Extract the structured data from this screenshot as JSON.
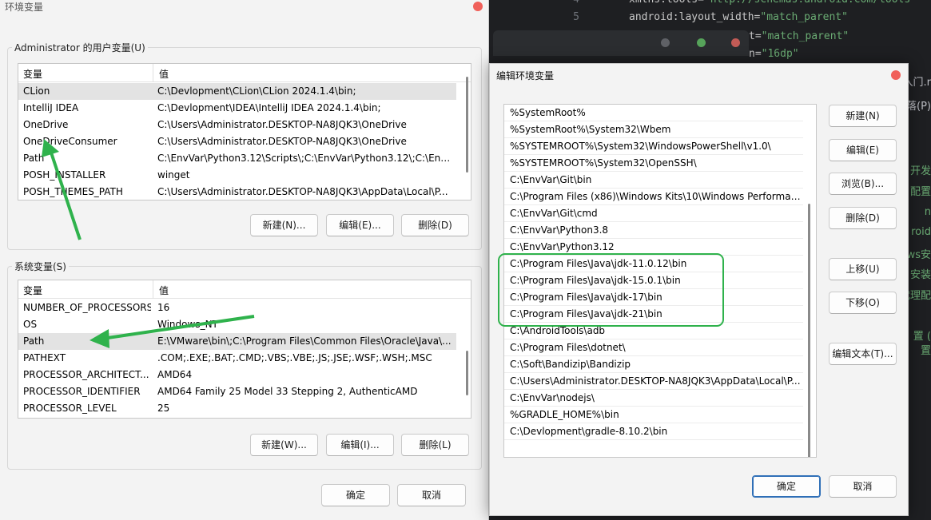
{
  "ide": {
    "lines": [
      {
        "num": "4",
        "attr": "xmlns:tools=",
        "val": "\"http://schemas.android.com/tools\""
      },
      {
        "num": "5",
        "attr": "android:layout_width=",
        "val": "\"match_parent\""
      },
      {
        "num": "",
        "attr": "t=",
        "val": "\"match_parent\""
      },
      {
        "num": "",
        "attr": "n=",
        "val": "\"16dp\""
      }
    ],
    "right_fragments": [
      "入门.r",
      "落(P)",
      "开发",
      "配置",
      "n",
      "roid",
      "ws安",
      "安装",
      "代理配",
      "置 (",
      "置"
    ],
    "right_fragment_colors": [
      "#bcbec4",
      "#bcbec4",
      "#6aab73",
      "#6aab73",
      "#6aab73",
      "#6aab73",
      "#6aab73",
      "#6aab73",
      "#6aab73",
      "#6aab73",
      "#6aab73"
    ]
  },
  "env_dialog": {
    "title": "环境变量",
    "user_group_label": "Administrator 的用户变量(U)",
    "system_group_label": "系统变量(S)",
    "col_name": "变量",
    "col_value": "值",
    "user_vars": [
      {
        "name": "CLion",
        "value": "C:\\Devlopment\\CLion\\CLion 2024.1.4\\bin;"
      },
      {
        "name": "IntelliJ IDEA",
        "value": "C:\\Devlopment\\IDEA\\IntelliJ IDEA 2024.1.4\\bin;"
      },
      {
        "name": "OneDrive",
        "value": "C:\\Users\\Administrator.DESKTOP-NA8JQK3\\OneDrive"
      },
      {
        "name": "OneDriveConsumer",
        "value": "C:\\Users\\Administrator.DESKTOP-NA8JQK3\\OneDrive"
      },
      {
        "name": "Path",
        "value": "C:\\EnvVar\\Python3.12\\Scripts\\;C:\\EnvVar\\Python3.12\\;C:\\EnvV..."
      },
      {
        "name": "POSH_INSTALLER",
        "value": "winget"
      },
      {
        "name": "POSH_THEMES_PATH",
        "value": "C:\\Users\\Administrator.DESKTOP-NA8JQK3\\AppData\\Local\\P..."
      }
    ],
    "system_vars": [
      {
        "name": "NUMBER_OF_PROCESSORS",
        "value": "16"
      },
      {
        "name": "OS",
        "value": "Windows_NT"
      },
      {
        "name": "Path",
        "value": "E:\\VMware\\bin\\;C:\\Program Files\\Common Files\\Oracle\\Java\\..."
      },
      {
        "name": "PATHEXT",
        "value": ".COM;.EXE;.BAT;.CMD;.VBS;.VBE;.JS;.JSE;.WSF;.WSH;.MSC"
      },
      {
        "name": "PROCESSOR_ARCHITECT...",
        "value": "AMD64"
      },
      {
        "name": "PROCESSOR_IDENTIFIER",
        "value": "AMD64 Family 25 Model 33 Stepping 2, AuthenticAMD"
      },
      {
        "name": "PROCESSOR_LEVEL",
        "value": "25"
      }
    ],
    "user_buttons": {
      "new": "新建(N)...",
      "edit": "编辑(E)...",
      "delete": "删除(D)"
    },
    "system_buttons": {
      "new": "新建(W)...",
      "edit": "编辑(I)...",
      "delete": "删除(L)"
    },
    "ok": "确定",
    "cancel": "取消"
  },
  "edit_dialog": {
    "title": "编辑环境变量",
    "paths": [
      "%SystemRoot%",
      "%SystemRoot%\\System32\\Wbem",
      "%SYSTEMROOT%\\System32\\WindowsPowerShell\\v1.0\\",
      "%SYSTEMROOT%\\System32\\OpenSSH\\",
      "C:\\EnvVar\\Git\\bin",
      "C:\\Program Files (x86)\\Windows Kits\\10\\Windows Performan...",
      "C:\\EnvVar\\Git\\cmd",
      "C:\\EnvVar\\Python3.8",
      "C:\\EnvVar\\Python3.12",
      "C:\\Program Files\\Java\\jdk-11.0.12\\bin",
      "C:\\Program Files\\Java\\jdk-15.0.1\\bin",
      "C:\\Program Files\\Java\\jdk-17\\bin",
      "C:\\Program Files\\Java\\jdk-21\\bin",
      "C:\\AndroidTools\\adb",
      "C:\\Program Files\\dotnet\\",
      "C:\\Soft\\Bandizip\\Bandizip",
      "C:\\Users\\Administrator.DESKTOP-NA8JQK3\\AppData\\Local\\P...",
      "C:\\EnvVar\\nodejs\\",
      "%GRADLE_HOME%\\bin",
      "C:\\Devlopment\\gradle-8.10.2\\bin"
    ],
    "buttons": {
      "new": "新建(N)",
      "edit": "编辑(E)",
      "browse": "浏览(B)...",
      "delete": "删除(D)",
      "move_up": "上移(U)",
      "move_down": "下移(O)",
      "edit_text": "编辑文本(T)..."
    },
    "ok": "确定",
    "cancel": "取消"
  },
  "colors": {
    "accent": "#2f6fb7",
    "annotation": "#2fb24c",
    "close": "#f0605a"
  }
}
